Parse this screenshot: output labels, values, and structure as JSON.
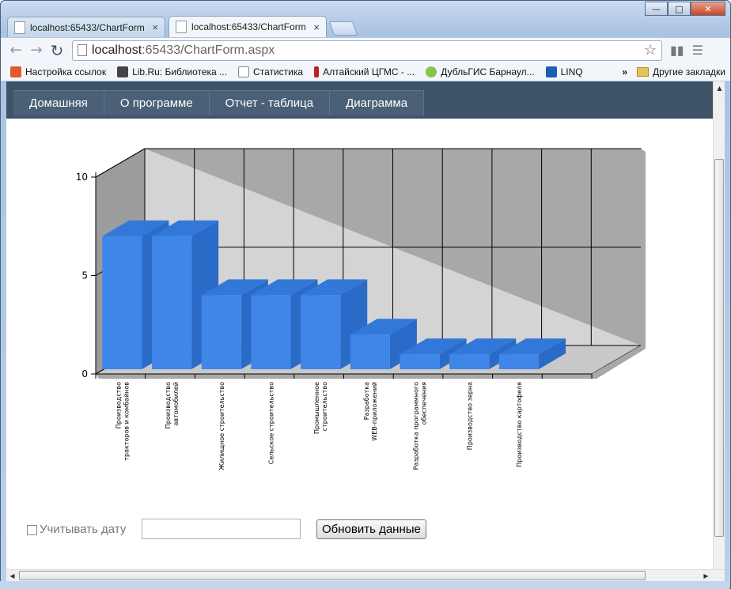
{
  "browser": {
    "tabs": [
      {
        "label": "localhost:65433/ChartForm",
        "close": "×"
      },
      {
        "label": "localhost:65433/ChartForm",
        "close": "×"
      }
    ],
    "url_host": "localhost",
    "url_rest": ":65433/ChartForm.aspx",
    "window_controls": {
      "minimize": "—",
      "maximize": "□",
      "close": "✕"
    },
    "bookmarks": [
      {
        "label": "Настройка ссылок",
        "icon": "windows-icon",
        "color": "#e05a2a"
      },
      {
        "label": "Lib.Ru: Библиотека ...",
        "icon": "lib-icon",
        "color": "#444444"
      },
      {
        "label": "Статистика",
        "icon": "page-icon",
        "color": "#ffffff"
      },
      {
        "label": "Алтайский ЦГМС - ...",
        "icon": "thermometer-icon",
        "color": "#c02020"
      },
      {
        "label": "ДубльГИС Барнаул...",
        "icon": "2gis-icon",
        "color": "#8bc34a"
      },
      {
        "label": "LINQ",
        "icon": "linq-icon",
        "color": "#1a5fb4"
      }
    ],
    "bookmarks_more": "»",
    "other_bookmarks": "Другие закладки"
  },
  "nav": {
    "items": [
      "Домашняя",
      "О программе",
      "Отчет - таблица",
      "Диаграмма"
    ]
  },
  "chart_data": {
    "type": "bar",
    "categories": [
      "Производство тракторов и комбайнов",
      "Производство автомобилей",
      "Жилищное строительство",
      "Сельское строительство",
      "Промышленное строительство",
      "Разработка WEB-приложений",
      "Разработка программного обеспечения",
      "Производство зерна",
      "Производство картофеля"
    ],
    "tick_lines": [
      [
        "Производство",
        "тракторов и комбайнов"
      ],
      [
        "Производство",
        "автомобилей"
      ],
      [
        "Жилищное строительство"
      ],
      [
        "Сельское строительство"
      ],
      [
        "Промышленное",
        "строительство"
      ],
      [
        "Разработка",
        "WEB-приложений"
      ],
      [
        "Разработка программного",
        "обеспечения"
      ],
      [
        "Производство зерна"
      ],
      [
        "Производство картофеля"
      ]
    ],
    "values": [
      7,
      7,
      4,
      4,
      4,
      2,
      1,
      1,
      1
    ],
    "ylim": [
      0,
      10
    ],
    "yticks": [
      "0",
      "5",
      "10"
    ],
    "grid": true,
    "bar_color": "#3f86e8",
    "title": "",
    "xlabel": "",
    "ylabel": ""
  },
  "form": {
    "checkbox_label": "Учитывать дату",
    "date_value": "",
    "refresh_label": "Обновить данные"
  }
}
